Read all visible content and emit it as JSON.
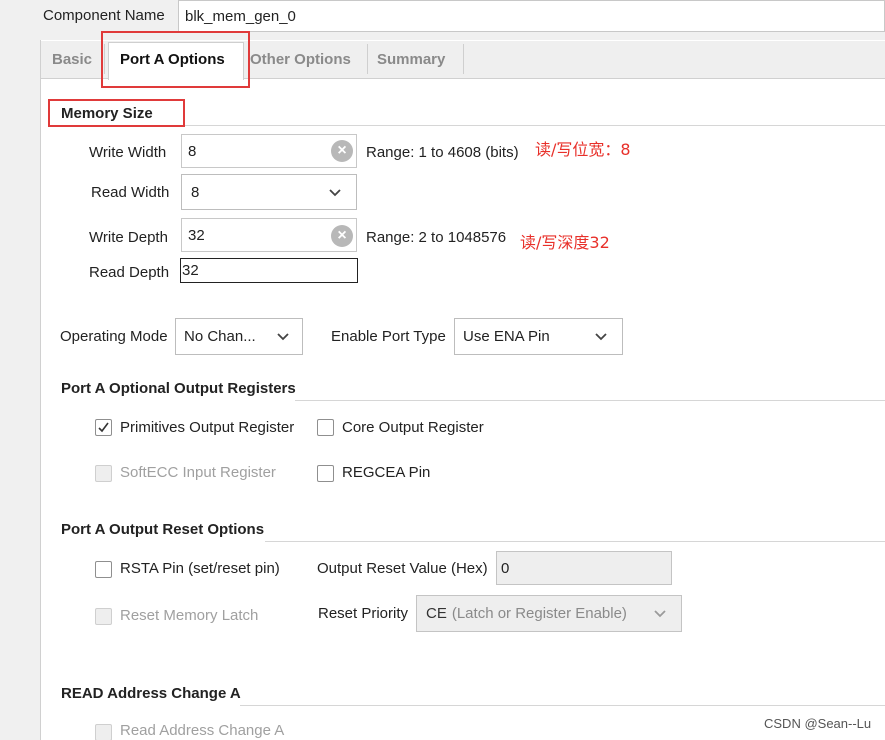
{
  "component": {
    "label": "Component Name",
    "value": "blk_mem_gen_0"
  },
  "tabs": [
    {
      "label": "Basic",
      "active": false
    },
    {
      "label": "Port A Options",
      "active": true
    },
    {
      "label": "Other Options",
      "active": false
    },
    {
      "label": "Summary",
      "active": false
    }
  ],
  "memory_size": {
    "title": "Memory Size",
    "write_width": {
      "label": "Write Width",
      "value": "8",
      "range": "Range: 1 to 4608 (bits)"
    },
    "read_width": {
      "label": "Read Width",
      "value": "8"
    },
    "write_depth": {
      "label": "Write Depth",
      "value": "32",
      "range": "Range: 2 to 1048576"
    },
    "read_depth": {
      "label": "Read Depth",
      "value": "32"
    }
  },
  "operating_mode": {
    "label": "Operating Mode",
    "value": "No Chan..."
  },
  "enable_port_type": {
    "label": "Enable Port Type",
    "value": "Use ENA Pin"
  },
  "optional_output_registers": {
    "title": "Port A Optional Output Registers",
    "primitives_output_register": {
      "label": "Primitives Output Register",
      "checked": true
    },
    "core_output_register": {
      "label": "Core Output Register",
      "checked": false
    },
    "softecc_input_register": {
      "label": "SoftECC Input Register",
      "checked": false,
      "disabled": true
    },
    "regcea_pin": {
      "label": "REGCEA Pin",
      "checked": false
    }
  },
  "output_reset_options": {
    "title": "Port A Output Reset Options",
    "rsta_pin": {
      "label": "RSTA Pin (set/reset pin)",
      "checked": false
    },
    "output_reset_value": {
      "label": "Output Reset Value (Hex)",
      "value": "0"
    },
    "reset_memory_latch": {
      "label": "Reset Memory Latch",
      "checked": false,
      "disabled": true
    },
    "reset_priority": {
      "label": "Reset Priority",
      "value_prefix": "CE",
      "value_suffix": "(Latch or Register Enable)"
    }
  },
  "read_address_change": {
    "title": "READ Address Change A",
    "checkbox_label": "Read Address Change A"
  },
  "annotations": {
    "width_note": "读/写位宽：8",
    "depth_note": "读/写深度32"
  },
  "watermark": "CSDN @Sean--Lu",
  "colors": {
    "highlight_box": "#e03a3a",
    "annotation_text": "#e8302a"
  }
}
